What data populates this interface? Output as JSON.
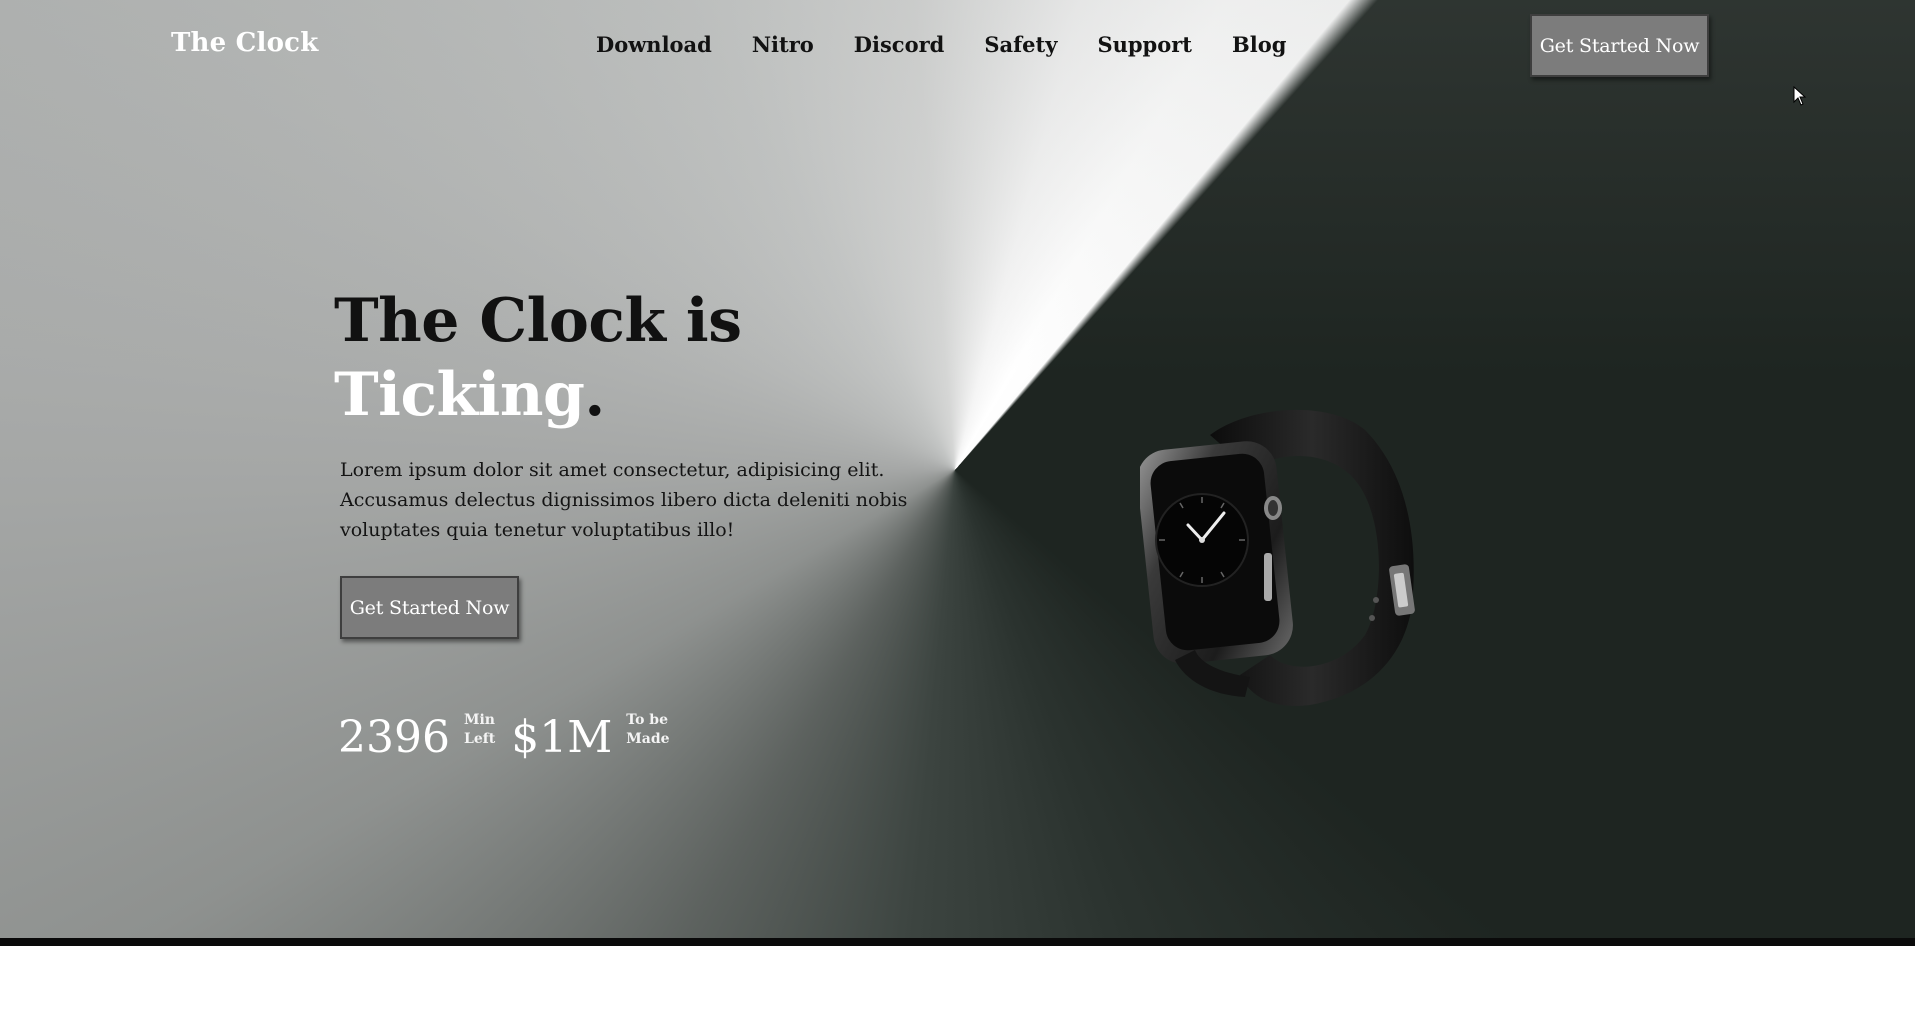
{
  "brand": {
    "logo": "The Clock"
  },
  "nav": {
    "items": [
      {
        "label": "Download"
      },
      {
        "label": "Nitro"
      },
      {
        "label": "Discord"
      },
      {
        "label": "Safety"
      },
      {
        "label": "Support"
      },
      {
        "label": "Blog"
      }
    ],
    "cta_label": "Get Started Now"
  },
  "hero": {
    "headline_line1": "The Clock is",
    "headline_line2": "Ticking",
    "headline_dot": ".",
    "description": "Lorem ipsum dolor sit amet consectetur, adipisicing elit. Accusamus delectus dignissimos libero dicta deleniti nobis voluptates quia tenetur voluptatibus illo!",
    "cta_label": "Get Started Now",
    "stats": [
      {
        "value": "2396",
        "label_line1": "Min",
        "label_line2": "Left"
      },
      {
        "value": "$1M",
        "label_line1": "To be",
        "label_line2": "Made"
      }
    ],
    "image": "smartwatch"
  },
  "colors": {
    "button_bg": "#7c7c7c",
    "dark_bg": "#1e2521",
    "text_dark": "#111111",
    "text_light": "#ffffff"
  }
}
